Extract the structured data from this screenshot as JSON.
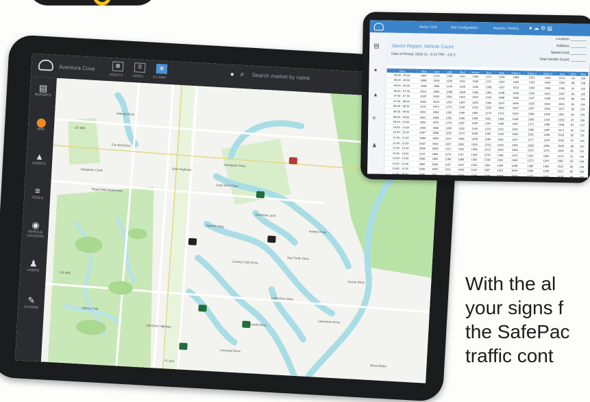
{
  "main_app": {
    "location": "Aventura Cove",
    "toolbar": [
      {
        "icon": "grid-icon",
        "label": "ASSETS"
      },
      {
        "icon": "list-icon",
        "label": "SIGNS"
      },
      {
        "icon": "map-icon",
        "label": "FC-MAP"
      }
    ],
    "search_placeholder": "Search market by name",
    "sidebar": [
      {
        "icon": "grid-icon",
        "label": "REPORTS"
      },
      {
        "icon": "map-pin-icon",
        "label": "MAP",
        "active": true
      },
      {
        "icon": "warning-icon",
        "label": "ALERTS"
      },
      {
        "icon": "sliders-icon",
        "label": "TOOLS"
      },
      {
        "icon": "location-icon",
        "label": "VEHICLE LOCATION"
      },
      {
        "icon": "users-icon",
        "label": "USERS"
      },
      {
        "icon": "wrench-icon",
        "label": "SYSTEM"
      }
    ],
    "map_labels": [
      "CR 888",
      "Dakota Drive",
      "Fox Bell Drive",
      "Sawgrass Circle",
      "Royal Palm Boulevard",
      "Coral Reef Drive",
      "Seminole Lane",
      "Country Club Drive",
      "Lake View Drive",
      "Dixie Highway",
      "CR 809",
      "Military Trail",
      "FL 804",
      "Lakeshore Drive",
      "Leewood Drive",
      "Boca Raton",
      "Mariner Way",
      "Sandpiper Drive",
      "Sea Turtle Drive",
      "Old Dixie Highway",
      "Ocean Drive",
      "Sunset Drive",
      "Harbor Point"
    ]
  },
  "report_app": {
    "nav": [
      "Alerts / Unit",
      "Site Configuration",
      "Reports / History"
    ],
    "title": "Jaxom Report: Vehicle Count",
    "period": "Date of Period: 2019-11 - 9.14 TRF - CS 2",
    "meta": [
      "Location: ________",
      "Address: ________",
      "Speed Limit: ________",
      "Total Vehicle Count: ________"
    ],
    "columns": [
      "Time",
      "Total",
      "Cars",
      "Light",
      "Med",
      "Heavy",
      "Bus",
      "Axle",
      "Class 1",
      "Class 2",
      "Class 3",
      "Avg",
      "85%",
      "Max"
    ],
    "rows": [
      [
        "05:00 - 05:30",
        "1994",
        "1215",
        "1368",
        "1201",
        "1284",
        "1471",
        "1309",
        "1686",
        "1563",
        "1595",
        "1510",
        "90",
        "129"
      ],
      [
        "05:30 - 06:00",
        "2008",
        "1978",
        "1326",
        "1251",
        "1180",
        "1371",
        "1303",
        "1640",
        "1343",
        "1549",
        "1543",
        "88",
        "128"
      ],
      [
        "06:00 - 06:30",
        "1938",
        "1966",
        "1244",
        "1335",
        "1165",
        "1338",
        "1337",
        "1613",
        "1554",
        "1556",
        "1506",
        "91",
        "122"
      ],
      [
        "06:30 - 07:00",
        "2013",
        "1992",
        "1288",
        "1258",
        "1300",
        "1393",
        "1348",
        "1536",
        "1354",
        "1521",
        "1597",
        "84",
        "130"
      ],
      [
        "07:00 - 07:30",
        "2030",
        "2053",
        "1382",
        "1363",
        "1400",
        "1443",
        "1288",
        "1369",
        "1347",
        "1348",
        "1525",
        "86",
        "126"
      ],
      [
        "07:30 - 08:00",
        "2082",
        "1979",
        "1263",
        "1304",
        "1325",
        "1396",
        "1324",
        "1566",
        "1335",
        "1562",
        "1602",
        "83",
        "128"
      ],
      [
        "08:00 - 08:30",
        "2131",
        "1974",
        "1273",
        "1318",
        "1318",
        "1333",
        "1309",
        "1507",
        "1387",
        "1336",
        "1517",
        "86",
        "132"
      ],
      [
        "08:30 - 09:00",
        "2042",
        "1954",
        "1293",
        "1306",
        "1390",
        "1279",
        "1273",
        "1533",
        "1388",
        "1349",
        "1592",
        "89",
        "129"
      ],
      [
        "09:00 - 09:30",
        "2061",
        "1969",
        "1282",
        "1295",
        "1309",
        "1381",
        "1255",
        "1444",
        "1393",
        "1316",
        "1578",
        "87",
        "136"
      ],
      [
        "09:30 - 10:00",
        "2000",
        "1975",
        "1276",
        "1287",
        "1340",
        "1342",
        "1283",
        "1547",
        "1371",
        "1358",
        "1548",
        "84",
        "127"
      ],
      [
        "10:00 - 10:30",
        "1936",
        "1982",
        "1283",
        "1332",
        "1343",
        "1310",
        "1331",
        "1537",
        "1386",
        "1387",
        "1571",
        "90",
        "133"
      ],
      [
        "10:30 - 11:00",
        "2007",
        "1968",
        "1236",
        "1370",
        "1328",
        "1383",
        "1330",
        "1552",
        "1391",
        "1355",
        "1518",
        "82",
        "131"
      ],
      [
        "11:00 - 11:30",
        "1994",
        "1953",
        "1314",
        "1385",
        "1338",
        "1396",
        "1281",
        "1447",
        "1377",
        "1370",
        "1534",
        "87",
        "129"
      ],
      [
        "11:30 - 12:00",
        "2057",
        "1942",
        "1297",
        "1381",
        "1303",
        "1319",
        "1316",
        "1406",
        "1368",
        "1396",
        "1565",
        "88",
        "124"
      ],
      [
        "12:00 - 12:30",
        "2059",
        "2005",
        "1321",
        "1320",
        "1356",
        "1413",
        "1300",
        "1565",
        "1343",
        "1373",
        "1559",
        "85",
        "131"
      ],
      [
        "12:30 - 13:00",
        "2101",
        "1964",
        "1279",
        "1337",
        "1328",
        "1379",
        "1296",
        "1474",
        "1360",
        "1361",
        "1574",
        "81",
        "129"
      ],
      [
        "13:00 - 13:30",
        "2056",
        "1992",
        "1296",
        "1380",
        "1362",
        "1339",
        "1341",
        "1563",
        "1373",
        "1374",
        "1581",
        "83",
        "126"
      ],
      [
        "13:30 - 14:00",
        "1993",
        "2063",
        "1267",
        "1322",
        "1394",
        "1384",
        "1294",
        "1548",
        "1386",
        "1364",
        "1523",
        "86",
        "129"
      ],
      [
        "14:00 - 14:30",
        "2030",
        "1953",
        "1261",
        "1336",
        "1342",
        "1397",
        "1315",
        "1504",
        "1394",
        "1378",
        "1512",
        "82",
        "130"
      ],
      [
        "14:30 - 15:00",
        "2080",
        "2011",
        "1306",
        "1325",
        "1346",
        "1349",
        "1318",
        "1545",
        "1377",
        "1397",
        "1535",
        "88",
        "128"
      ],
      [
        "15:00 - 15:30",
        "2045",
        "1981",
        "1290",
        "1331",
        "1354",
        "1386",
        "1329",
        "1526",
        "1383",
        "1398",
        "1542",
        "84",
        "131"
      ],
      [
        "15:30 - 16:00",
        "2004",
        "1968",
        "1302",
        "1344",
        "1347",
        "1402",
        "1320",
        "1512",
        "1379",
        "1360",
        "1521",
        "86",
        "128"
      ]
    ]
  },
  "caption_lines": [
    "With the al",
    "your signs f",
    "the SafePac",
    "traffic cont"
  ]
}
